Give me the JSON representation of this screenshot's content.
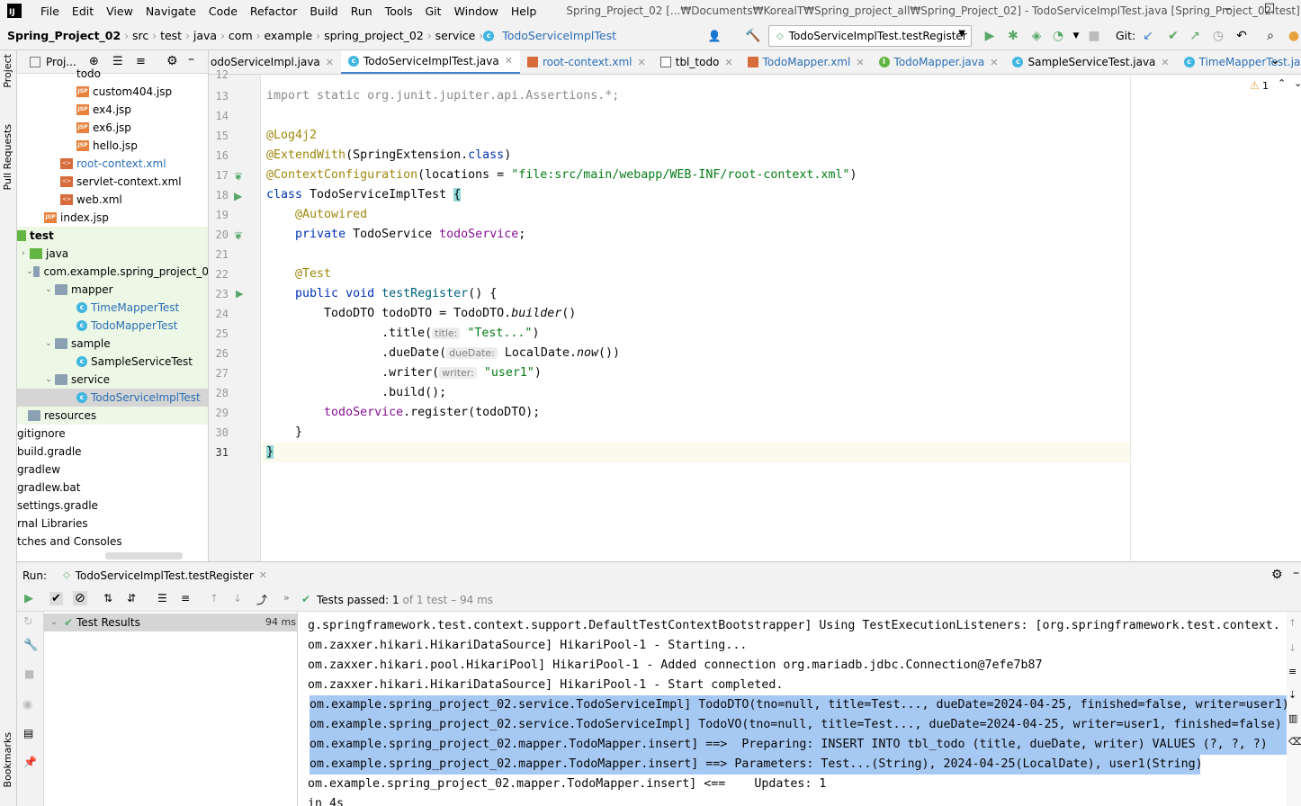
{
  "menu": {
    "items": [
      "File",
      "Edit",
      "View",
      "Navigate",
      "Code",
      "Refactor",
      "Build",
      "Run",
      "Tools",
      "Git",
      "Window",
      "Help"
    ],
    "title": "Spring_Project_02 [...₩Documents₩KorealT₩Spring_project_all₩Spring_Project_02] - TodoServiceImplTest.java [Spring_Project_02.test]"
  },
  "nav": {
    "crumbs": [
      "Spring_Project_02",
      "src",
      "test",
      "java",
      "com",
      "example",
      "spring_project_02",
      "service",
      "TodoServiceImplTest"
    ],
    "run_config": "TodoServiceImplTest.testRegister",
    "git_label": "Git:"
  },
  "stripe": {
    "project": "Project",
    "pull_requests": "Pull Requests",
    "bookmarks": "Bookmarks"
  },
  "project": {
    "header": "Proj...",
    "tree": [
      {
        "label": "todo",
        "icon": "folder"
      },
      {
        "label": "custom404.jsp",
        "icon": "jsp"
      },
      {
        "label": "ex4.jsp",
        "icon": "jsp"
      },
      {
        "label": "ex6.jsp",
        "icon": "jsp"
      },
      {
        "label": "hello.jsp",
        "icon": "jsp"
      },
      {
        "label": "root-context.xml",
        "icon": "xml"
      },
      {
        "label": "servlet-context.xml",
        "icon": "xml"
      },
      {
        "label": "web.xml",
        "icon": "xml"
      },
      {
        "label": "index.jsp",
        "icon": "jsp"
      },
      {
        "label": "test",
        "icon": "folder"
      },
      {
        "label": "java",
        "icon": "folder-green"
      },
      {
        "label": "com.example.spring_project_0",
        "icon": "folder"
      },
      {
        "label": "mapper",
        "icon": "folder"
      },
      {
        "label": "TimeMapperTest",
        "icon": "class"
      },
      {
        "label": "TodoMapperTest",
        "icon": "class"
      },
      {
        "label": "sample",
        "icon": "folder"
      },
      {
        "label": "SampleServiceTest",
        "icon": "class"
      },
      {
        "label": "service",
        "icon": "folder"
      },
      {
        "label": "TodoServiceImplTest",
        "icon": "class"
      },
      {
        "label": "resources",
        "icon": "folder"
      },
      {
        "label": "gitignore",
        "icon": "none"
      },
      {
        "label": "build.gradle",
        "icon": "none"
      },
      {
        "label": "gradlew",
        "icon": "none"
      },
      {
        "label": "gradlew.bat",
        "icon": "none"
      },
      {
        "label": "settings.gradle",
        "icon": "none"
      },
      {
        "label": "rnal Libraries",
        "icon": "none"
      },
      {
        "label": "tches and Consoles",
        "icon": "none"
      }
    ]
  },
  "tabs": [
    {
      "label": "odoServiceImpl.java",
      "icon": "class"
    },
    {
      "label": "TodoServiceImplTest.java",
      "icon": "class"
    },
    {
      "label": "root-context.xml",
      "icon": "xml"
    },
    {
      "label": "tbl_todo",
      "icon": "table"
    },
    {
      "label": "TodoMapper.xml",
      "icon": "xml"
    },
    {
      "label": "TodoMapper.java",
      "icon": "interface"
    },
    {
      "label": "SampleServiceTest.java",
      "icon": "class"
    },
    {
      "label": "TimeMapperTest.java",
      "icon": "class"
    }
  ],
  "editor": {
    "warnings": "1",
    "line_numbers": [
      "12",
      "13",
      "14",
      "15",
      "16",
      "17",
      "18",
      "19",
      "20",
      "21",
      "22",
      "23",
      "24",
      "25",
      "26",
      "27",
      "28",
      "29",
      "30",
      "31"
    ],
    "code": {
      "l13_a": "import static ",
      "l13_b": "org.junit.jupiter.api.Assertions.*;",
      "l15": "@Log4j2",
      "l16_a": "@ExtendWith",
      "l16_b": "(SpringExtension.",
      "l16_c": "class",
      "l16_d": ")",
      "l17_a": "@ContextConfiguration",
      "l17_b": "(locations = ",
      "l17_c": "\"file:src/main/webapp/WEB-INF/root-context.xml\"",
      "l17_d": ")",
      "l18_a": "class ",
      "l18_b": "TodoServiceImplTest ",
      "l18_c": "{",
      "l19": "@Autowired",
      "l20_a": "private ",
      "l20_b": "TodoService ",
      "l20_c": "todoService",
      "l20_d": ";",
      "l22": "@Test",
      "l23_a": "public void ",
      "l23_b": "testRegister",
      "l23_c": "() {",
      "l24_a": "TodoDTO todoDTO = TodoDTO.",
      "l24_b": "builder",
      "l24_c": "()",
      "l25_a": ".title(",
      "l25_hint": "title:",
      "l25_b": "\"Test...\"",
      "l25_c": ")",
      "l26_a": ".dueDate(",
      "l26_hint": "dueDate:",
      "l26_b": "LocalDate.",
      "l26_c": "now",
      "l26_d": "())",
      "l27_a": ".writer(",
      "l27_hint": "writer:",
      "l27_b": "\"user1\"",
      "l27_c": ")",
      "l28": ".build();",
      "l29_a": "todoService",
      "l29_b": ".register(todoDTO);",
      "l30": "}",
      "l31": "}"
    }
  },
  "run": {
    "label": "Run:",
    "tab": "TodoServiceImplTest.testRegister",
    "status_prefix": "Tests passed:",
    "status_count": "1",
    "status_suffix": "of 1 test – 94 ms",
    "results_label": "Test Results",
    "results_time": "94 ms",
    "console": [
      "g.springframework.test.context.support.DefaultTestContextBootstrapper] Using TestExecutionListeners: [org.springframework.test.context.",
      "om.zaxxer.hikari.HikariDataSource] HikariPool-1 - Starting...",
      "om.zaxxer.hikari.pool.HikariPool] HikariPool-1 - Added connection org.mariadb.jdbc.Connection@7efe7b87",
      "om.zaxxer.hikari.HikariDataSource] HikariPool-1 - Start completed.",
      "om.example.spring_project_02.service.TodoServiceImpl] TodoDTO(tno=null, title=Test..., dueDate=2024-04-25, finished=false, writer=user1)",
      "om.example.spring_project_02.service.TodoServiceImpl] TodoVO(tno=null, title=Test..., dueDate=2024-04-25, writer=user1, finished=false)",
      "om.example.spring_project_02.mapper.TodoMapper.insert] ==>  Preparing: INSERT INTO tbl_todo (title, dueDate, writer) VALUES (?, ?, ?)",
      "om.example.spring_project_02.mapper.TodoMapper.insert] ==> Parameters: Test...(String), 2024-04-25(LocalDate), user1(String)",
      "om.example.spring_project_02.mapper.TodoMapper.insert] <==    Updates: 1",
      "in 4s"
    ]
  },
  "colors": {
    "accent": "#4083c9",
    "pass": "#59a869",
    "selection": "#a6c9f4"
  }
}
